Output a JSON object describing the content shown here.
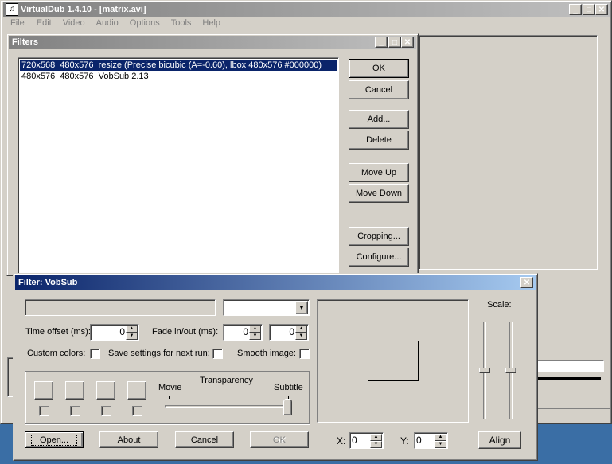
{
  "main_window": {
    "title": "VirtualDub 1.4.10 - [matrix.avi]",
    "menu": [
      "File",
      "Edit",
      "Video",
      "Audio",
      "Options",
      "Tools",
      "Help"
    ]
  },
  "filters_dialog": {
    "title": "Filters",
    "items": [
      "720x568  480x576  resize (Precise bicubic (A=-0.60), lbox 480x576 #000000)",
      "480x576  480x576  VobSub 2.13"
    ],
    "selected_index": 0,
    "buttons": {
      "ok": "OK",
      "cancel": "Cancel",
      "add": "Add...",
      "delete": "Delete",
      "move_up": "Move Up",
      "move_down": "Move Down",
      "cropping": "Cropping...",
      "configure": "Configure..."
    }
  },
  "vobsub_dialog": {
    "title": "Filter: VobSub",
    "file_path": "",
    "language_select": "",
    "time_offset_label": "Time offset (ms):",
    "time_offset": "0",
    "fade_label": "Fade in/out (ms):",
    "fade_in": "0",
    "fade_out": "0",
    "custom_colors_label": "Custom colors:",
    "custom_colors": false,
    "save_settings_label": "Save settings for next run:",
    "save_settings": false,
    "smooth_image_label": "Smooth image:",
    "smooth_image": false,
    "transparency_label": "Transparency",
    "movie_label": "Movie",
    "subtitle_label": "Subtitle",
    "transparency_value_percent": 100,
    "scale_label": "Scale:",
    "scale_x_percent": 50,
    "scale_y_percent": 50,
    "x_label": "X:",
    "x_value": "0",
    "y_label": "Y:",
    "y_value": "0",
    "buttons": {
      "open": "Open...",
      "about": "About",
      "cancel": "Cancel",
      "ok": "OK",
      "align": "Align"
    }
  },
  "colors": {
    "desktop": "#3a6ea5",
    "selection": "#0a246a",
    "active_title_start": "#0a246a",
    "active_title_end": "#a6caf0"
  }
}
